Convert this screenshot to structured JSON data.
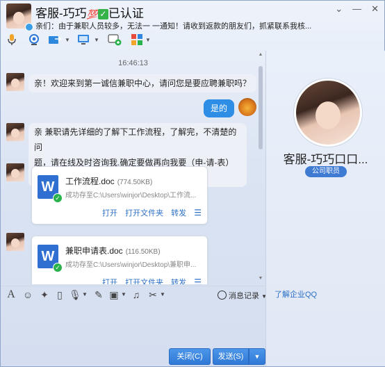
{
  "header": {
    "title": "客服-巧巧",
    "title_badge": "💯",
    "title_check": "✓",
    "title_suffix": "已认证",
    "notice": "亲们：由于兼职人员较多，无法一 一通知！请收到返款的朋友们，抓紧联系我核..."
  },
  "window_controls": {
    "menu": "⌄",
    "minimize": "—",
    "close": "✕"
  },
  "toolbar": {
    "icons": [
      "microphone-icon",
      "video-icon",
      "transfer-file-icon",
      "remote-desktop-icon",
      "add-chat-icon",
      "apps-icon"
    ]
  },
  "chat": {
    "timestamp": "16:46:13",
    "messages": [
      {
        "from": "them",
        "text": "亲！欢迎来到第一诚信兼职中心，请问您是要应聘兼职吗？"
      },
      {
        "from": "me",
        "text": "是的"
      },
      {
        "from": "them",
        "line1": "亲 兼职请先详细的了解下工作流程，了解完，不清楚的问",
        "line2": "题，请在线及时咨询我.确定要做再向我要（申-请-表）填写."
      }
    ],
    "files": [
      {
        "name": "工作流程.doc",
        "size": "(774.50KB)",
        "path": "成功存至C:\\Users\\winjor\\Desktop\\工作流...",
        "actions": [
          "打开",
          "打开文件夹",
          "转发"
        ]
      },
      {
        "name": "兼职申请表.doc",
        "size": "(116.50KB)",
        "path": "成功存至C:\\Users\\winjor\\Desktop\\兼职申...",
        "actions": [
          "打开",
          "打开文件夹",
          "转发"
        ]
      }
    ],
    "file_icon_letter": "W"
  },
  "profile": {
    "name": "客服-巧巧口口...",
    "role": "公司职员",
    "learn_link": "了解企业QQ"
  },
  "input_toolbar": {
    "history_label": "消息记录"
  },
  "buttons": {
    "close": "关闭(C)",
    "send": "发送(S)",
    "send_arrow": "▼"
  }
}
